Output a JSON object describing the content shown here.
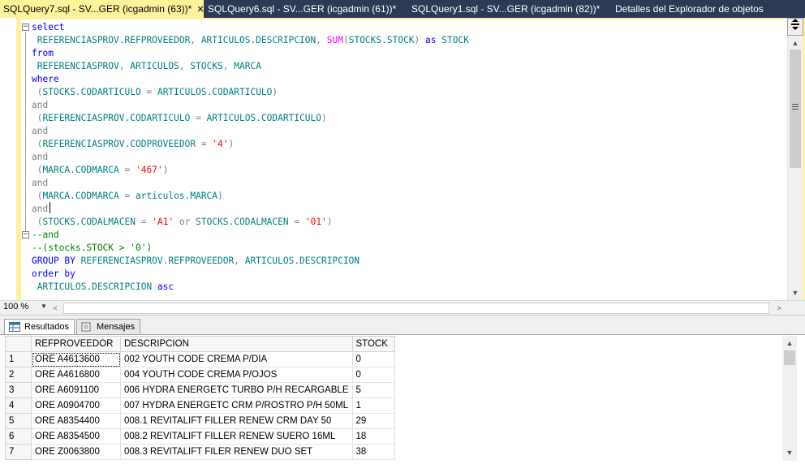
{
  "tabs": [
    {
      "label": "SQLQuery7.sql - SV...GER (icgadmin (63))*",
      "active": true,
      "close": "✕"
    },
    {
      "label": "SQLQuery6.sql - SV...GER (icgadmin (61))*",
      "active": false
    },
    {
      "label": "SQLQuery1.sql - SV...GER (icgadmin (82))*",
      "active": false
    },
    {
      "label": "Detalles del Explorador de objetos",
      "active": false
    }
  ],
  "editor": {
    "lines": [
      [
        {
          "t": "select",
          "c": "kw"
        }
      ],
      [
        {
          "t": " REFERENCIASPROV.REFPROVEEDOR",
          "c": "tl"
        },
        {
          "t": ", ",
          "c": "gr"
        },
        {
          "t": "ARTICULOS.DESCRIPCION",
          "c": "tl"
        },
        {
          "t": ", ",
          "c": "gr"
        },
        {
          "t": "SUM",
          "c": "fn"
        },
        {
          "t": "(",
          "c": "gr"
        },
        {
          "t": "STOCKS.STOCK",
          "c": "tl"
        },
        {
          "t": ") ",
          "c": "gr"
        },
        {
          "t": "as",
          "c": "kw"
        },
        {
          "t": " STOCK",
          "c": "tl"
        }
      ],
      [
        {
          "t": "from",
          "c": "kw"
        }
      ],
      [
        {
          "t": " REFERENCIASPROV",
          "c": "tl"
        },
        {
          "t": ", ",
          "c": "gr"
        },
        {
          "t": "ARTICULOS",
          "c": "tl"
        },
        {
          "t": ", ",
          "c": "gr"
        },
        {
          "t": "STOCKS",
          "c": "tl"
        },
        {
          "t": ", ",
          "c": "gr"
        },
        {
          "t": "MARCA",
          "c": "tl"
        }
      ],
      [
        {
          "t": "where",
          "c": "kw"
        }
      ],
      [
        {
          "t": " (",
          "c": "gr"
        },
        {
          "t": "STOCKS.CODARTICULO",
          "c": "tl"
        },
        {
          "t": " = ",
          "c": "gr"
        },
        {
          "t": "ARTICULOS.CODARTICULO",
          "c": "tl"
        },
        {
          "t": ")",
          "c": "gr"
        }
      ],
      [
        {
          "t": "and",
          "c": "gr"
        }
      ],
      [
        {
          "t": " (",
          "c": "gr"
        },
        {
          "t": "REFERENCIASPROV.CODARTICULO",
          "c": "tl"
        },
        {
          "t": " = ",
          "c": "gr"
        },
        {
          "t": "ARTICULOS.CODARTICULO",
          "c": "tl"
        },
        {
          "t": ")",
          "c": "gr"
        }
      ],
      [
        {
          "t": "and",
          "c": "gr"
        }
      ],
      [
        {
          "t": " (",
          "c": "gr"
        },
        {
          "t": "REFERENCIASPROV.CODPROVEEDOR",
          "c": "tl"
        },
        {
          "t": " = ",
          "c": "gr"
        },
        {
          "t": "'4'",
          "c": "st"
        },
        {
          "t": ")",
          "c": "gr"
        }
      ],
      [
        {
          "t": "and",
          "c": "gr"
        }
      ],
      [
        {
          "t": " (",
          "c": "gr"
        },
        {
          "t": "MARCA.CODMARCA",
          "c": "tl"
        },
        {
          "t": " = ",
          "c": "gr"
        },
        {
          "t": "'467'",
          "c": "st"
        },
        {
          "t": ")",
          "c": "gr"
        }
      ],
      [
        {
          "t": "and",
          "c": "gr"
        }
      ],
      [
        {
          "t": " (",
          "c": "gr"
        },
        {
          "t": "MARCA.CODMARCA",
          "c": "tl"
        },
        {
          "t": " = ",
          "c": "gr"
        },
        {
          "t": "articulos.MARCA",
          "c": "tl"
        },
        {
          "t": ")",
          "c": "gr"
        }
      ],
      [
        {
          "t": "and",
          "c": "gr"
        }
      ],
      [
        {
          "t": " (",
          "c": "gr"
        },
        {
          "t": "STOCKS.CODALMACEN",
          "c": "tl"
        },
        {
          "t": " = ",
          "c": "gr"
        },
        {
          "t": "'A1'",
          "c": "st"
        },
        {
          "t": " or ",
          "c": "gr"
        },
        {
          "t": "STOCKS.CODALMACEN",
          "c": "tl"
        },
        {
          "t": " = ",
          "c": "gr"
        },
        {
          "t": "'01'",
          "c": "st"
        },
        {
          "t": ")",
          "c": "gr"
        }
      ],
      [
        {
          "t": "--and",
          "c": "cm"
        }
      ],
      [
        {
          "t": "--(stocks.STOCK > '0')",
          "c": "cm"
        }
      ],
      [
        {
          "t": "GROUP BY",
          "c": "kw"
        },
        {
          "t": " REFERENCIASPROV.REFPROVEEDOR",
          "c": "tl"
        },
        {
          "t": ", ",
          "c": "gr"
        },
        {
          "t": "ARTICULOS.DESCRIPCION",
          "c": "tl"
        }
      ],
      [
        {
          "t": "order by",
          "c": "kw"
        }
      ],
      [
        {
          "t": " ARTICULOS.DESCRIPCION",
          "c": "tl"
        },
        {
          "t": " asc",
          "c": "kw"
        }
      ]
    ]
  },
  "icons": {
    "split": "split-icon",
    "fold_open": "−",
    "grip": "≡",
    "arrow_up": "▲",
    "arrow_down": "▼",
    "arrow_left": "<",
    "arrow_right": ">",
    "dropdown": "▼"
  },
  "zoom": {
    "value": "100 %"
  },
  "results_tabs": [
    {
      "label": "Resultados",
      "active": true
    },
    {
      "label": "Mensajes",
      "active": false
    }
  ],
  "grid": {
    "columns": [
      "REFPROVEEDOR",
      "DESCRIPCION",
      "STOCK"
    ],
    "rows": [
      {
        "n": "1",
        "ref": "ORE A4613600",
        "desc": "002 YOUTH CODE CREMA P/DIA",
        "stock": "0"
      },
      {
        "n": "2",
        "ref": "ORE A4616800",
        "desc": "004 YOUTH CODE CREMA P/OJOS",
        "stock": "0"
      },
      {
        "n": "3",
        "ref": "ORE A6091100",
        "desc": "006 HYDRA ENERGETC TURBO P/H RECARGABLE",
        "stock": "5"
      },
      {
        "n": "4",
        "ref": "ORE A0904700",
        "desc": "007 HYDRA ENERGETC CRM P/ROSTRO P/H 50ML",
        "stock": "1"
      },
      {
        "n": "5",
        "ref": "ORE A8354400",
        "desc": "008.1 REVITALIFT FILLER RENEW CRM DAY 50",
        "stock": "29"
      },
      {
        "n": "6",
        "ref": "ORE A8354500",
        "desc": "008.2 REVITALIFT FILLER RENEW SUERO 16ML",
        "stock": "18"
      },
      {
        "n": "7",
        "ref": "ORE Z0063800",
        "desc": "008.3 REVITALIFT FILER RENEW DUO SET",
        "stock": "38"
      }
    ]
  }
}
